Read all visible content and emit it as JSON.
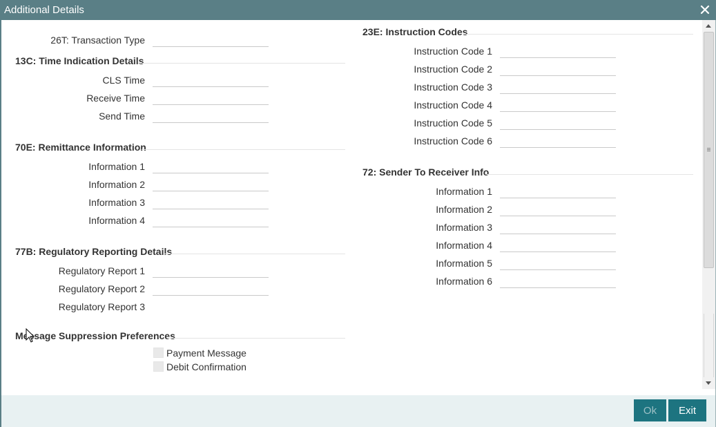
{
  "window": {
    "title": "Additional Details",
    "close_icon": "close-icon"
  },
  "transaction_type": {
    "label": "26T: Transaction Type",
    "value": ""
  },
  "time_indication": {
    "title": "13C: Time Indication Details",
    "fields": [
      {
        "label": "CLS Time",
        "value": ""
      },
      {
        "label": "Receive Time",
        "value": ""
      },
      {
        "label": "Send Time",
        "value": ""
      }
    ]
  },
  "remittance": {
    "title": "70E: Remittance Information",
    "fields": [
      {
        "label": "Information 1",
        "value": ""
      },
      {
        "label": "Information 2",
        "value": ""
      },
      {
        "label": "Information 3",
        "value": ""
      },
      {
        "label": "Information 4",
        "value": ""
      }
    ]
  },
  "regulatory": {
    "title": "77B: Regulatory Reporting Details",
    "fields": [
      {
        "label": "Regulatory Report 1",
        "value": ""
      },
      {
        "label": "Regulatory Report 2",
        "value": ""
      },
      {
        "label": "Regulatory Report 3",
        "value": ""
      }
    ]
  },
  "suppression": {
    "title": "Message Suppression Preferences",
    "options": [
      {
        "label": "Payment Message",
        "checked": false
      },
      {
        "label": "Debit Confirmation",
        "checked": false
      }
    ]
  },
  "instruction_codes": {
    "title": "23E: Instruction Codes",
    "fields": [
      {
        "label": "Instruction Code 1",
        "value": ""
      },
      {
        "label": "Instruction Code 2",
        "value": ""
      },
      {
        "label": "Instruction Code 3",
        "value": ""
      },
      {
        "label": "Instruction Code 4",
        "value": ""
      },
      {
        "label": "Instruction Code 5",
        "value": ""
      },
      {
        "label": "Instruction Code 6",
        "value": ""
      }
    ]
  },
  "sender_to_receiver": {
    "title": "72: Sender To Receiver Info",
    "fields": [
      {
        "label": "Information 1",
        "value": ""
      },
      {
        "label": "Information 2",
        "value": ""
      },
      {
        "label": "Information 3",
        "value": ""
      },
      {
        "label": "Information 4",
        "value": ""
      },
      {
        "label": "Information 5",
        "value": ""
      },
      {
        "label": "Information 6",
        "value": ""
      }
    ]
  },
  "footer": {
    "ok_label": "Ok",
    "exit_label": "Exit"
  },
  "colors": {
    "titlebar": "#5a7f86",
    "button": "#1d7480",
    "footer": "#e8f1f2"
  }
}
